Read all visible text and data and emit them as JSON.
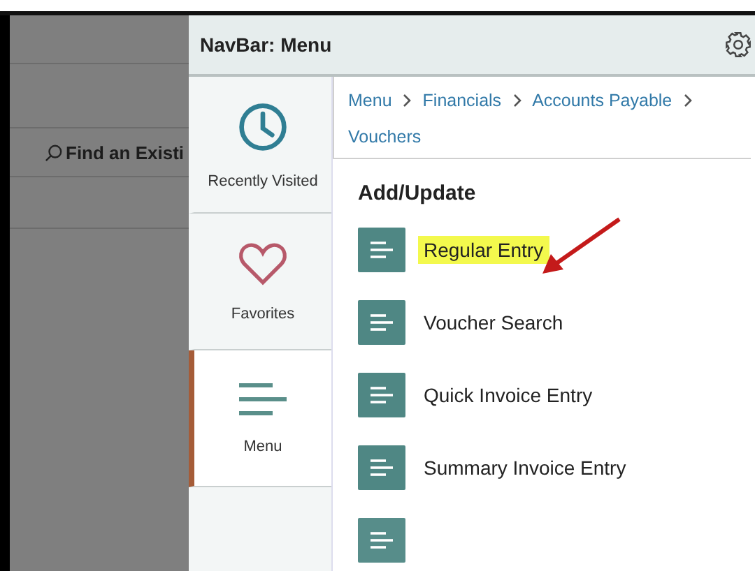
{
  "background": {
    "search": {
      "label": "Find an Existi"
    }
  },
  "navbar": {
    "title": "NavBar: Menu",
    "tabs": [
      {
        "label": "Recently Visited",
        "kind": "clock",
        "selected": false
      },
      {
        "label": "Favorites",
        "kind": "heart",
        "selected": false
      },
      {
        "label": "Menu",
        "kind": "menu",
        "selected": true
      }
    ],
    "breadcrumbs": [
      "Menu",
      "Financials",
      "Accounts Payable",
      "Vouchers"
    ],
    "section": "Add/Update",
    "items": [
      {
        "label": "Regular Entry",
        "highlighted": true
      },
      {
        "label": "Voucher Search",
        "highlighted": false
      },
      {
        "label": "Quick Invoice Entry",
        "highlighted": false
      },
      {
        "label": "Summary Invoice Entry",
        "highlighted": false
      },
      {
        "kind": "partial"
      }
    ]
  }
}
